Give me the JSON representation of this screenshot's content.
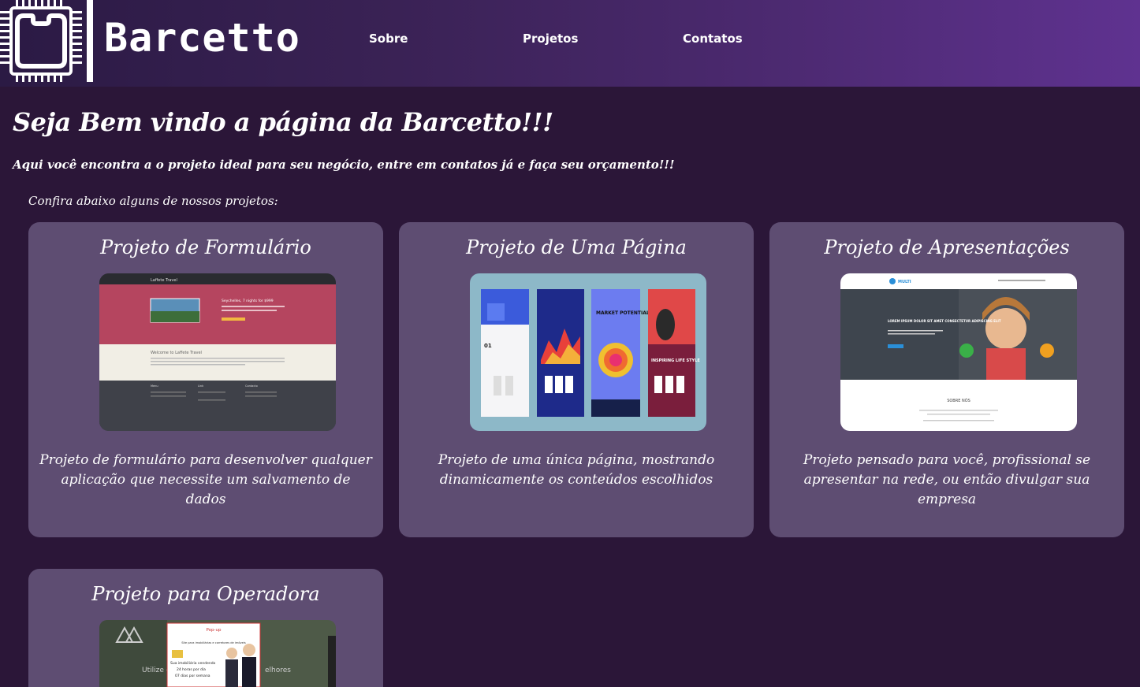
{
  "header": {
    "brand": "Barcetto",
    "logo_icon": "chip-icon",
    "nav": [
      "Sobre",
      "Projetos",
      "Contatos"
    ]
  },
  "main": {
    "welcome": "Seja Bem vindo a página da Barcetto!!!",
    "subtitle": "Aqui você encontra a o projeto ideal para seu negócio, entre em contatos já e faça seu orçamento!!!",
    "intro": "Confira abaixo alguns de nossos projetos:"
  },
  "cards": [
    {
      "title": "Projeto de Formulário",
      "description": "Projeto de formulário para desenvolver qualquer aplicação que necessite um salvamento de dados",
      "thumb": {
        "site_title": "Laffete Travel",
        "hero_heading": "Seychelles, 7 nights for $999",
        "welcome": "Welcome to Laffete Travel",
        "footer_cols": [
          "Menu",
          "Link",
          "Contacto"
        ]
      }
    },
    {
      "title": "Projeto de Uma Página",
      "description": "Projeto de uma única página, mostrando dinamicamente os conteúdos escolhidos",
      "thumb": {
        "panel_labels": [
          "01",
          "MARKET POTENTIAL",
          "INSPIRING LIFE STYLE"
        ]
      }
    },
    {
      "title": "Projeto de Apresentações",
      "description": "Projeto pensado para você, profissional se apresentar na rede, ou então divulgar sua empresa",
      "thumb": {
        "brand": "MULTI",
        "hero_text": "LOREM IPSUM DOLOR SIT AMET CONSECTETUR ADIPISCING ELIT",
        "section": "SOBRE NÓS"
      }
    },
    {
      "title": "Projeto para Operadora",
      "description": "",
      "thumb": {
        "popup_title": "Pop-up",
        "popup_line1": "Site para imobiliárias e corretores de imóveis",
        "popup_line2": "Sua imobiliária vendendo",
        "popup_line3": "24 horas por dia",
        "popup_line4": "07 dias por semana",
        "side_left": "Utilize e",
        "side_right": "elhores"
      }
    }
  ],
  "colors": {
    "background": "#2b1638",
    "card": "#5e4d72",
    "header_start": "#2b1a44",
    "header_end": "#5f3290"
  }
}
